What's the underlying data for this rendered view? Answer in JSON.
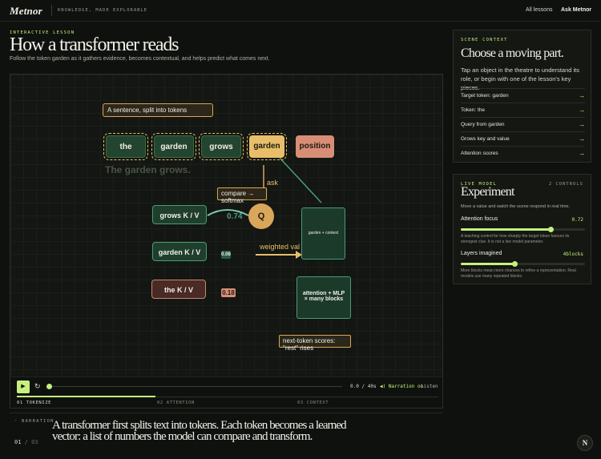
{
  "nav": {
    "logo": "Metnor",
    "tagline": "KNOWLEDGE, MADE EXPLORABLE",
    "lessons": "All lessons",
    "ask": "Ask Metnor"
  },
  "header": {
    "eyebrow": "INTERACTIVE LESSON",
    "title": "How a transformer reads",
    "subtitle": "Follow the token garden as it gathers evidence, becomes contextual, and helps predict what comes next."
  },
  "scene": {
    "sentence_label": "A sentence, split into tokens",
    "tokens": [
      "the",
      "garden",
      "grows",
      "garden",
      "position"
    ],
    "ghost_sentence": "The garden grows.",
    "ask_label": "ask",
    "compare_label": "compare → softmax",
    "q_label": "Q",
    "kv": [
      {
        "label": "grows K / V",
        "score": "0.74"
      },
      {
        "label": "garden K / V",
        "score": "0.08"
      },
      {
        "label": "the K / V",
        "score": "0.18"
      }
    ],
    "weighted_label": "weighted val",
    "context_box": "garden + context",
    "mlp_box_line1": "attention + MLP",
    "mlp_box_line2": "× many blocks",
    "next_token": "next-token scores: \"rest\" rises"
  },
  "player": {
    "play_icon": "▶",
    "replay_icon": "↻",
    "time_current": "0.0",
    "time_sep": "/",
    "time_total": "40s",
    "narration_toggle": "Narration on",
    "listen": "Listen",
    "progress_fraction": 0.0,
    "chapters": [
      "01 TOKENIZE",
      "02 ATTENTION",
      "03 CONTEXT"
    ],
    "chapter_fill_fraction": 0.33
  },
  "narration": {
    "label": "NARRATION",
    "current": "01",
    "sep": "/",
    "total": "03",
    "text": "A transformer first splits text into tokens. Each token becomes a learned vector: a list of numbers the model can compare and transform."
  },
  "context_panel": {
    "eyebrow": "SCENE CONTEXT",
    "title": "Choose a moving part.",
    "desc": "Tap an object in the theatre to understand its role, or begin with one of the lesson's key pieces.",
    "items": [
      "Target token: garden",
      "Token: the",
      "Query from garden",
      "Grows key and value",
      "Attention scores"
    ],
    "arrow": "→"
  },
  "experiment_panel": {
    "eyebrow": "LIVE MODEL",
    "count": "2 CONTROLS",
    "title": "Experiment",
    "desc": "Move a value and watch the scene respond in real time.",
    "attention": {
      "label": "Attention focus",
      "value": "0.72",
      "fraction": 0.72,
      "help": "A teaching control for how sharply the target token favours its strongest clue. It is not a live model parameter."
    },
    "layers": {
      "label": "Layers imagined",
      "value": "4blocks",
      "fraction": 0.43,
      "help": "More blocks mean more chances to refine a representation. Real models use many repeated blocks."
    }
  },
  "fab": "N",
  "colors": {
    "accent": "#c6f080",
    "amber": "#d9a65a",
    "teal": "#4a9a7a",
    "coral": "#d88e76",
    "background": "#0f110e"
  }
}
